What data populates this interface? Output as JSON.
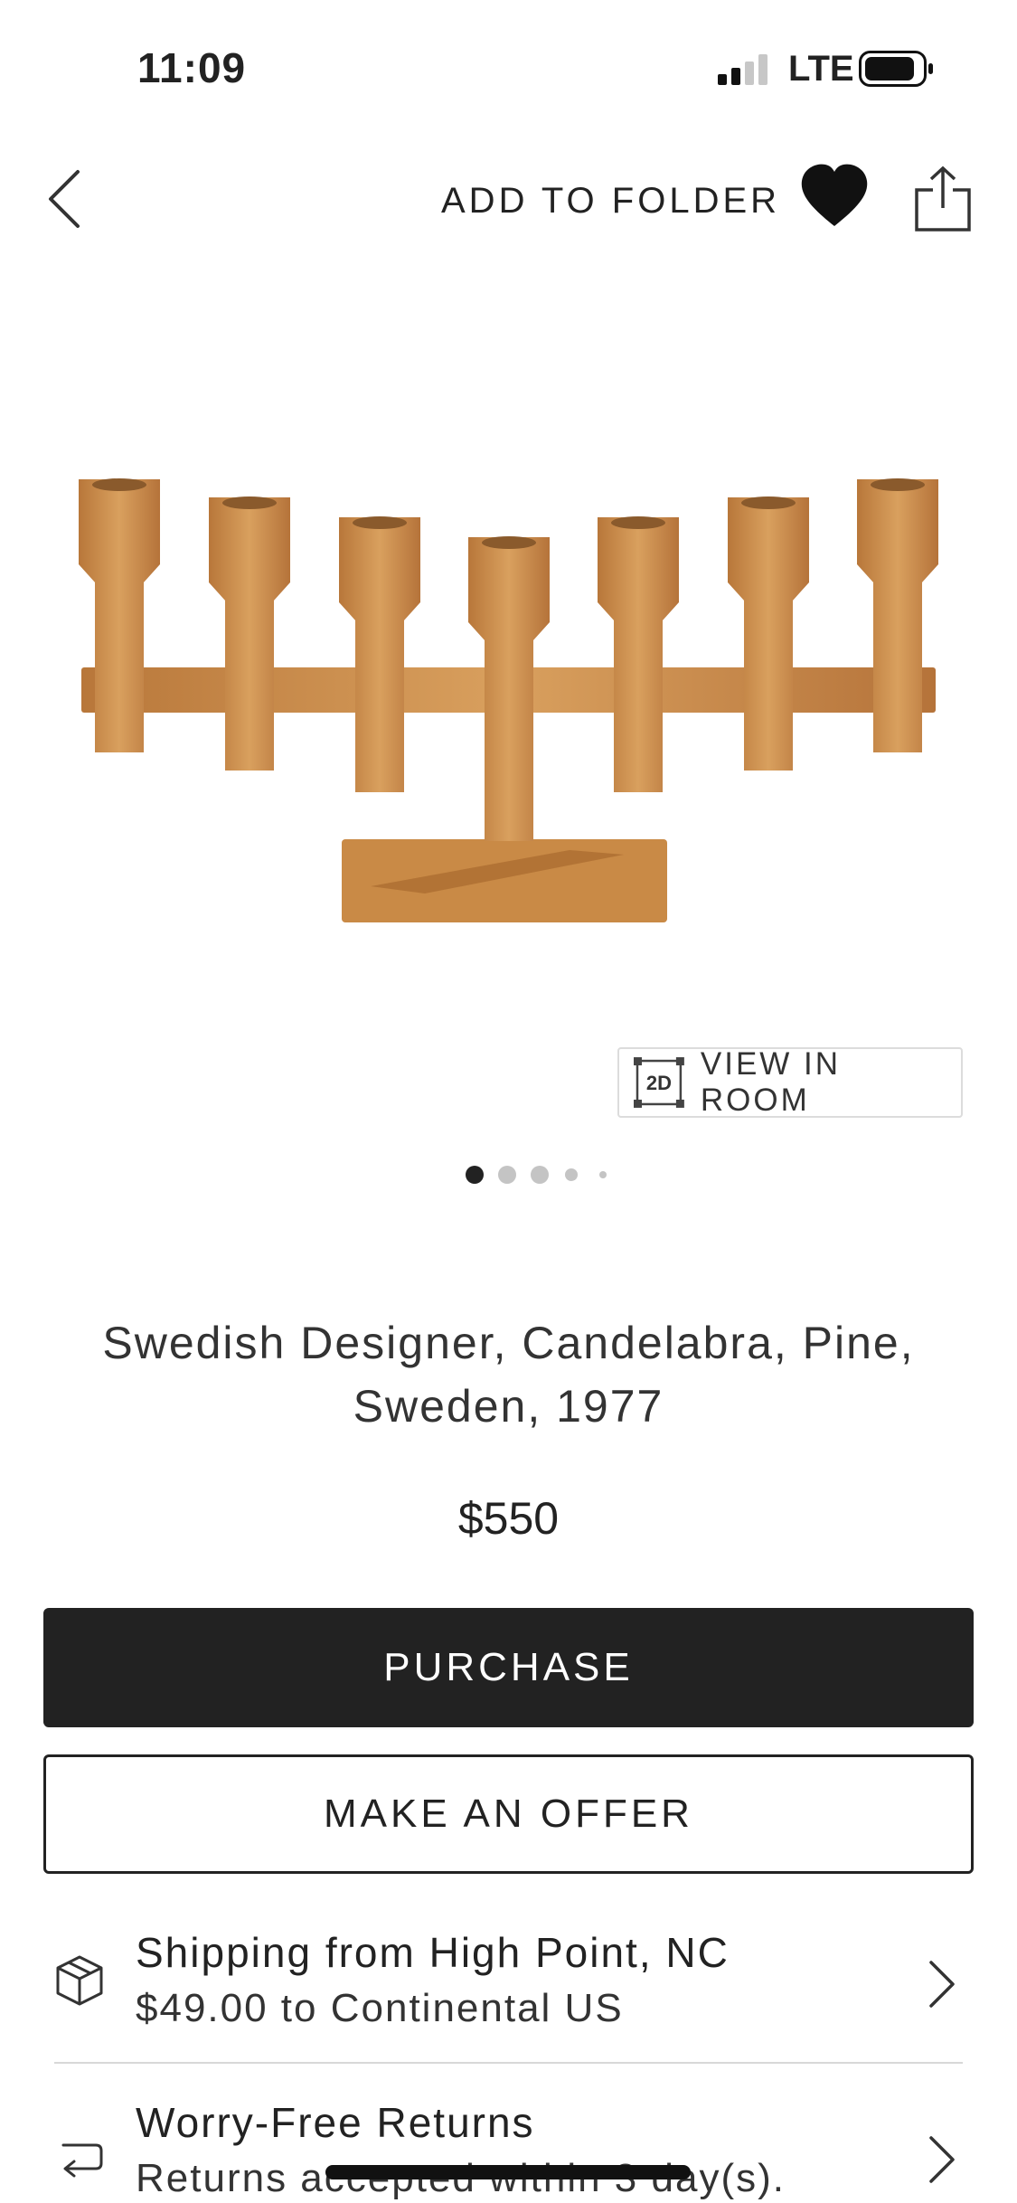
{
  "status_bar": {
    "time": "11:09",
    "network": "LTE"
  },
  "nav": {
    "add_to_folder": "ADD TO FOLDER",
    "back_icon": "chevron-left-icon",
    "heart_icon": "heart-icon",
    "share_icon": "share-icon"
  },
  "product": {
    "image": "candelabra-photo",
    "view_in_room_badge": "2D",
    "view_in_room_label": "VIEW IN ROOM",
    "carousel": {
      "total": 5,
      "active": 1
    },
    "title": "Swedish Designer, Candelabra, Pine, Sweden, 1977",
    "price": "$550"
  },
  "actions": {
    "purchase": "PURCHASE",
    "make_offer": "MAKE AN OFFER"
  },
  "info": {
    "shipping": {
      "title": "Shipping from High Point, NC",
      "detail": "$49.00 to Continental US",
      "icon": "box-icon"
    },
    "returns": {
      "title": "Worry-Free Returns",
      "detail": "Returns accepted within 3 day(s).",
      "icon": "return-arrow-icon"
    }
  },
  "colors": {
    "primary_button": "#222222",
    "background": "#ffffff",
    "wood": "#c98a46"
  }
}
